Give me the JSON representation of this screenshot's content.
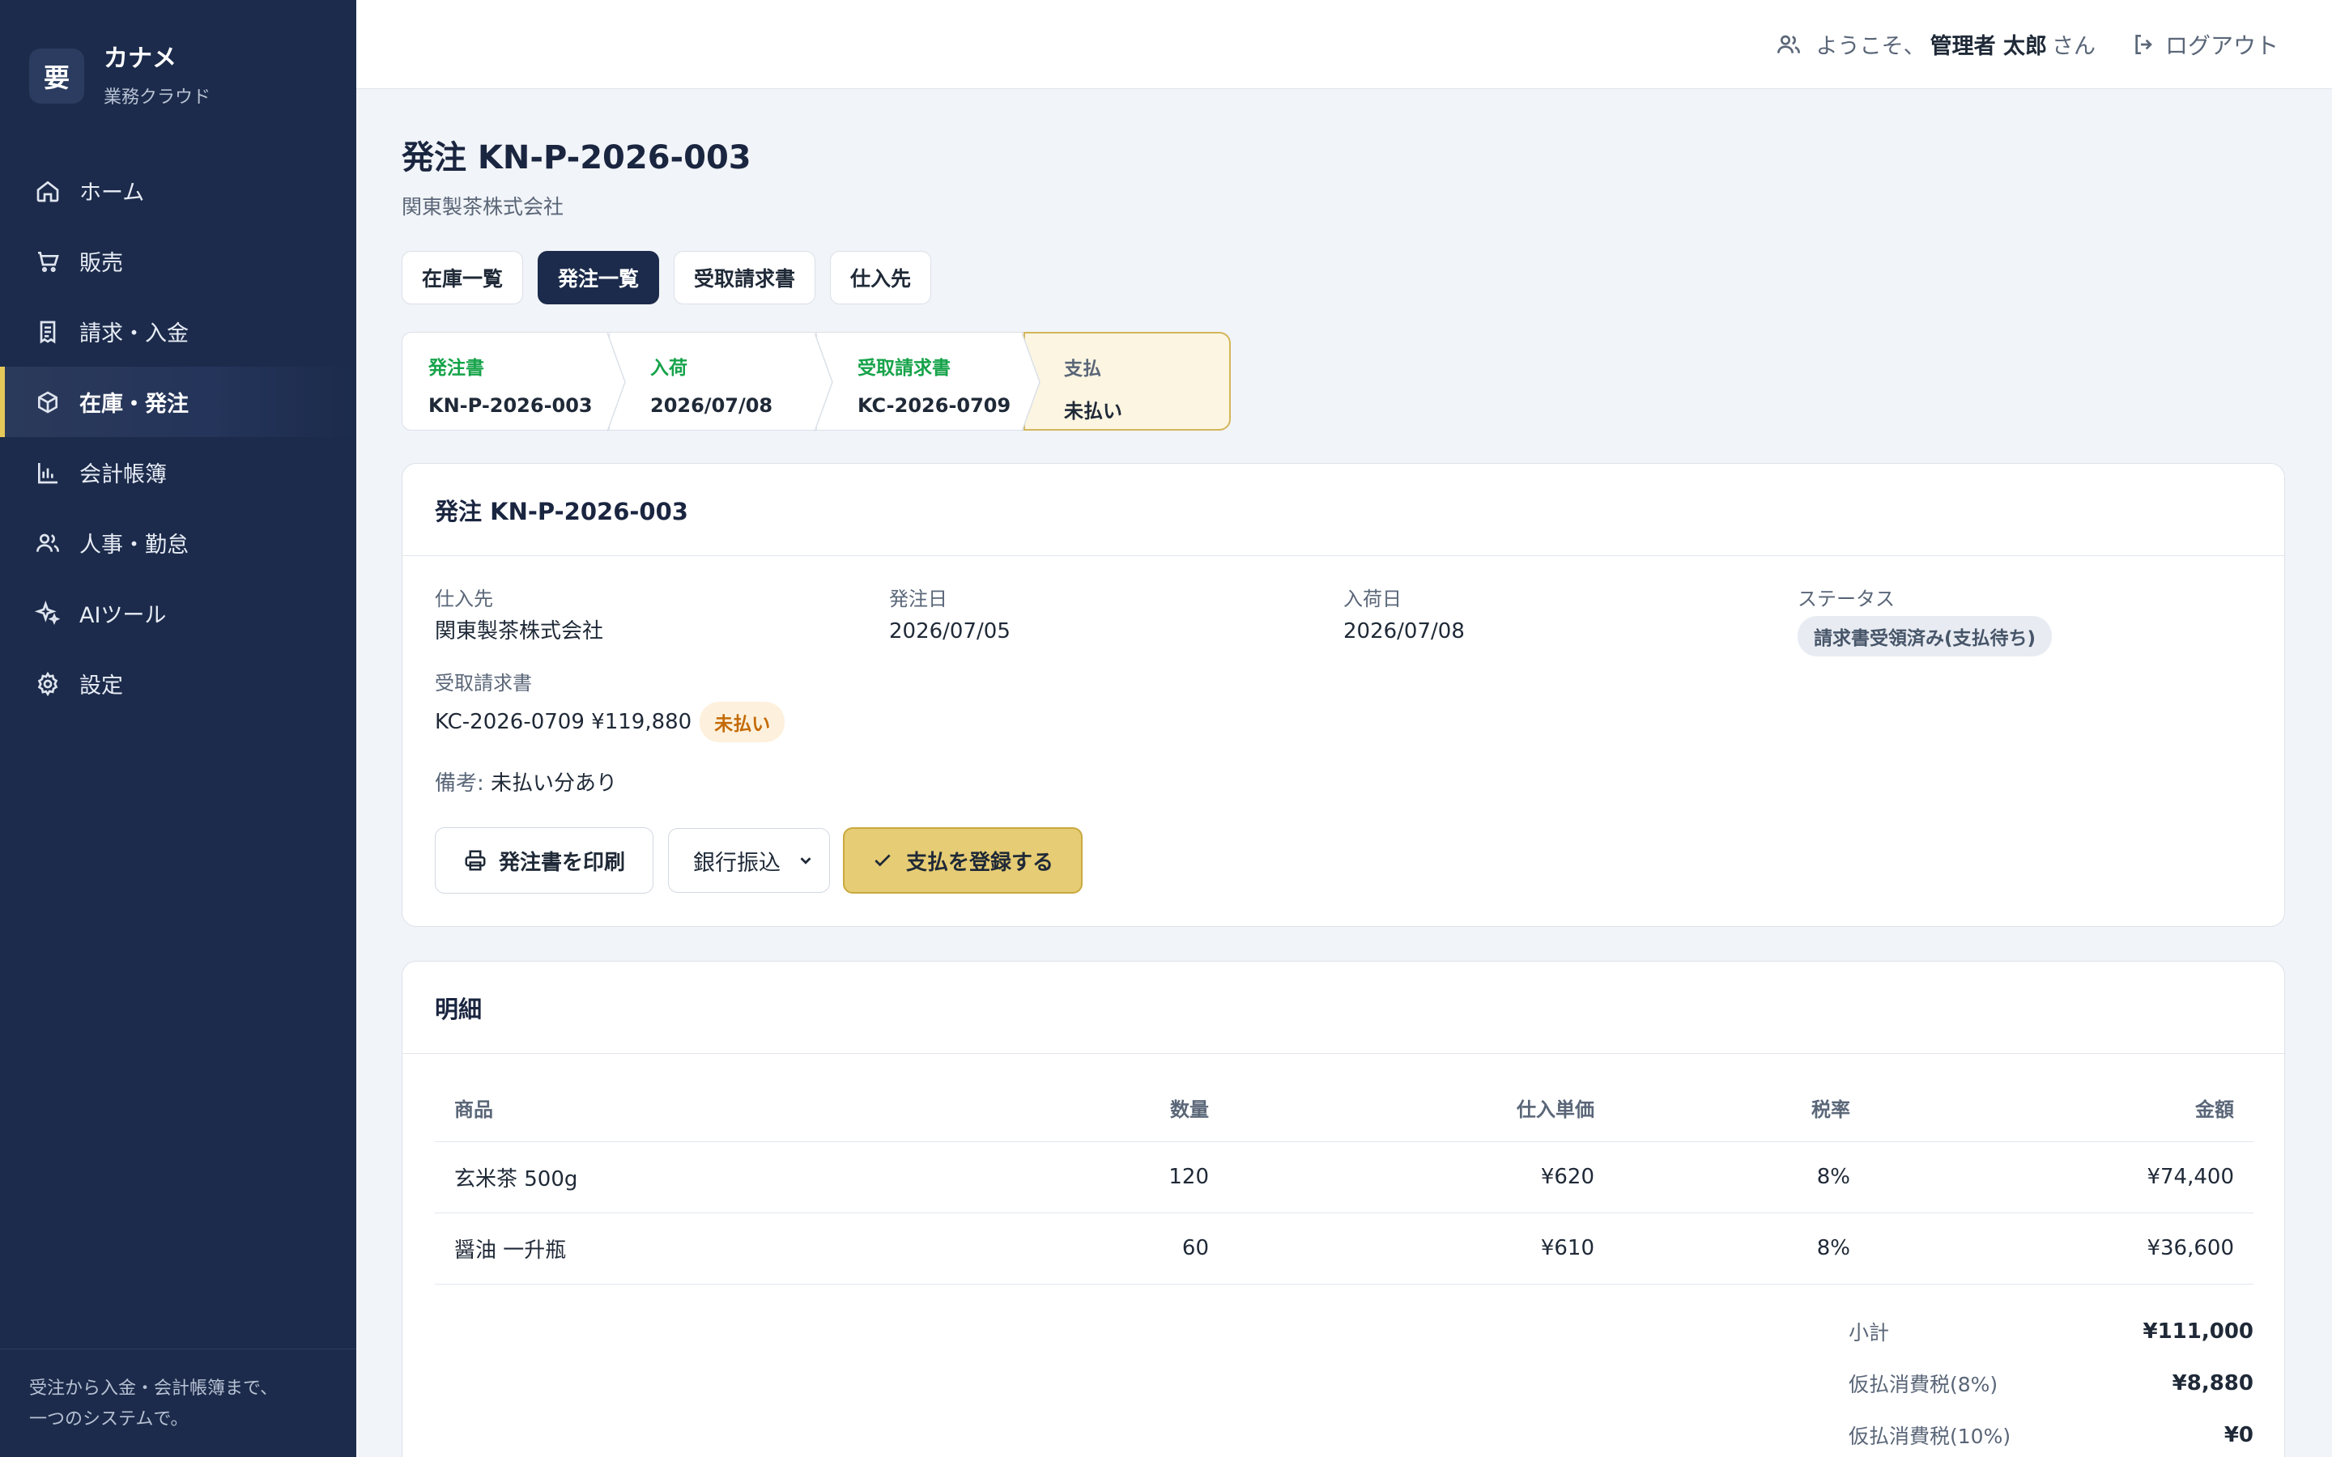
{
  "brand": {
    "logo_char": "要",
    "name": "カナメ",
    "subtitle": "業務クラウド"
  },
  "sidebar": {
    "items": [
      {
        "label": "ホーム",
        "icon": "home-icon"
      },
      {
        "label": "販売",
        "icon": "cart-icon"
      },
      {
        "label": "請求・入金",
        "icon": "receipt-icon"
      },
      {
        "label": "在庫・発注",
        "icon": "box-icon",
        "active": true
      },
      {
        "label": "会計帳簿",
        "icon": "bar-chart-icon"
      },
      {
        "label": "人事・勤怠",
        "icon": "users-icon"
      },
      {
        "label": "AIツール",
        "icon": "sparkle-icon"
      },
      {
        "label": "設定",
        "icon": "gear-icon"
      }
    ],
    "footer_line1": "受注から入金・会計帳簿まで、",
    "footer_line2": "一つのシステムで。"
  },
  "topbar": {
    "welcome_prefix": "ようこそ、",
    "user_name": "管理者 太郎",
    "welcome_suffix": "さん",
    "logout_label": "ログアウト"
  },
  "page": {
    "title": "発注 KN-P-2026-003",
    "subtitle": "関東製茶株式会社"
  },
  "tabs": [
    {
      "label": "在庫一覧"
    },
    {
      "label": "発注一覧",
      "active": true
    },
    {
      "label": "受取請求書"
    },
    {
      "label": "仕入先"
    }
  ],
  "steps": [
    {
      "label": "発注書",
      "value": "KN-P-2026-003"
    },
    {
      "label": "入荷",
      "value": "2026/07/08"
    },
    {
      "label": "受取請求書",
      "value": "KC-2026-0709"
    },
    {
      "label": "支払",
      "value": "未払い"
    }
  ],
  "detail": {
    "header": "発注 KN-P-2026-003",
    "supplier_label": "仕入先",
    "supplier_value": "関東製茶株式会社",
    "order_date_label": "発注日",
    "order_date_value": "2026/07/05",
    "arrival_date_label": "入荷日",
    "arrival_date_value": "2026/07/08",
    "status_label": "ステータス",
    "status_value": "請求書受領済み(支払待ち)",
    "invoice_label": "受取請求書",
    "invoice_value": "KC-2026-0709 ¥119,880",
    "invoice_badge": "未払い",
    "memo_key": "備考:",
    "memo_value": "未払い分あり",
    "print_button": "発注書を印刷",
    "payment_method": "銀行振込",
    "register_button": "支払を登録する"
  },
  "lines": {
    "header": "明細",
    "columns": [
      "商品",
      "数量",
      "仕入単価",
      "税率",
      "金額"
    ],
    "rows": [
      {
        "item": "玄米茶 500g",
        "qty": "120",
        "price": "¥620",
        "tax": "8%",
        "amount": "¥74,400"
      },
      {
        "item": "醤油 一升瓶",
        "qty": "60",
        "price": "¥610",
        "tax": "8%",
        "amount": "¥36,600"
      }
    ],
    "totals": [
      {
        "label": "小計",
        "value": "¥111,000"
      },
      {
        "label": "仮払消費税(8%)",
        "value": "¥8,880"
      },
      {
        "label": "仮払消費税(10%)",
        "value": "¥0"
      }
    ]
  },
  "colors": {
    "sidebar_bg": "#1c2b4b",
    "accent_gold": "#e6cc74",
    "success_green": "#16a34a",
    "warning_orange": "#c46a06"
  }
}
